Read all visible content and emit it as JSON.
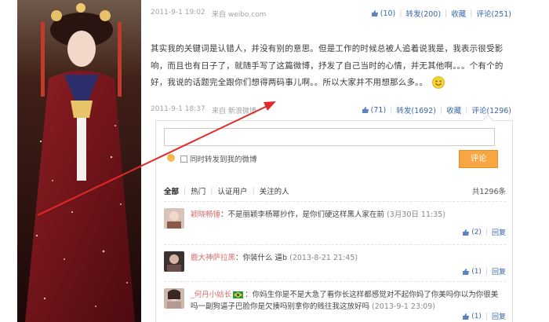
{
  "post1": {
    "time": "2011-9-1 19:02",
    "source_prefix": "来自",
    "source_link": "weibo.com",
    "like_count": "(10)",
    "repost": "转发(200)",
    "favorite": "收藏",
    "comment": "评论(251)"
  },
  "post2": {
    "text": "其实我的关键词是认错人，并没有别的意思。但是工作的时候总被人追着说我是，我表示很受影响，而且也有日子了，就随手写了这篇微博，抒发了自己当时的心情，并无其他啊。。。个有个的好，我说的话题完全跟你们想得两码事儿啊。。所以大家并不用想那么多。。",
    "time": "2011-9-1 18:37",
    "source_prefix": "来自",
    "source_link": "新浪微博",
    "like_count": "(71)",
    "repost": "转发(1692)",
    "favorite": "收藏",
    "comment": "评论(1296)"
  },
  "comment_box": {
    "input_placeholder": "",
    "forward_label": "同时转发到我的微博",
    "submit_label": "评论"
  },
  "filters": {
    "all": "全部",
    "hot": "热门",
    "verified": "认证用户",
    "following": "关注的人",
    "total": "共1296条"
  },
  "comments": [
    {
      "user": "颖晓畅锤",
      "text": "：不是丽颖李杨幂抄作，是你们硬这样黑人家在前",
      "time": "(3月30日 11:35)",
      "likes": "(2)",
      "reply": "回复"
    },
    {
      "user": "鹿大神萨拉黑",
      "text": "：你装什么 逼b",
      "time": "(2013-8-21 21:45)",
      "likes": "(1)",
      "reply": "回复"
    },
    {
      "user": "_何丹小姑长",
      "text": "：你妈生你是不是大急了看你长这样都感觉对不起你妈了你美吗你以为你很美吗一副狗逼子巴脸你是欠揍吗别拿你的贱往我这放好吗",
      "time": "(2013-9-1 23:09)",
      "likes": "(1)",
      "reply": "回复"
    }
  ],
  "colors": {
    "link": "#3867a8",
    "username": "#d96f6f",
    "submit": "#f8a641",
    "arrow": "#e02a2a"
  }
}
